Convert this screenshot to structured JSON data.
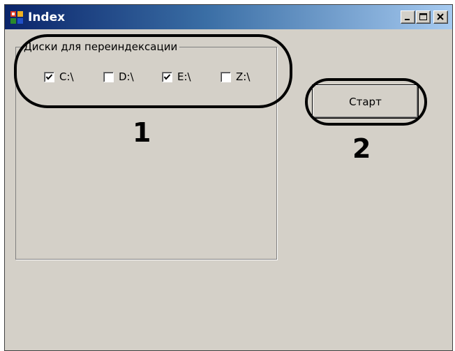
{
  "window": {
    "title": "Index",
    "buttons": {
      "minimize": "minimize-icon",
      "maximize": "maximize-icon",
      "close": "close-icon"
    }
  },
  "group": {
    "legend": "Диски для переиндексации",
    "drives": [
      {
        "label": "C:\\",
        "checked": true
      },
      {
        "label": "D:\\",
        "checked": false
      },
      {
        "label": "E:\\",
        "checked": true
      },
      {
        "label": "Z:\\",
        "checked": false
      }
    ]
  },
  "start_button": {
    "label": "Старт"
  },
  "annotations": {
    "callout_1": "1",
    "callout_2": "2"
  },
  "colors": {
    "titlebar_start": "#0a246a",
    "titlebar_end": "#a6caf0",
    "face": "#d4d0c8"
  }
}
